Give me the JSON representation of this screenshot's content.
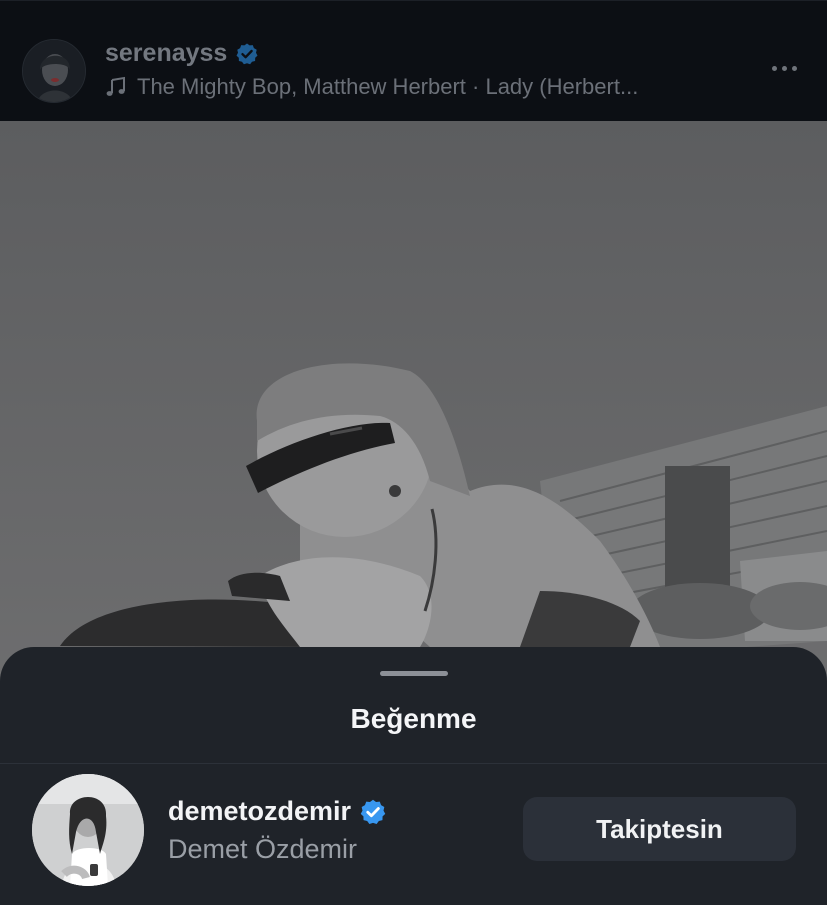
{
  "post": {
    "username": "serenayss",
    "verified": true,
    "music_text": "The Mighty Bop, Matthew Herbert · Lady (Herbert...",
    "icons": {
      "music": "music-note-icon",
      "more": "more-options-icon",
      "verified": "verified-badge-icon"
    }
  },
  "likes_sheet": {
    "title": "Beğenme",
    "likers": [
      {
        "username": "demetozdemir",
        "verified": true,
        "full_name": "Demet Özdemir",
        "follow_label": "Takiptesin"
      }
    ]
  },
  "colors": {
    "verified_blue": "#3897f0",
    "sheet_background": "#1f2329",
    "header_background": "#0c0f14",
    "follow_button": "#2b3039"
  }
}
